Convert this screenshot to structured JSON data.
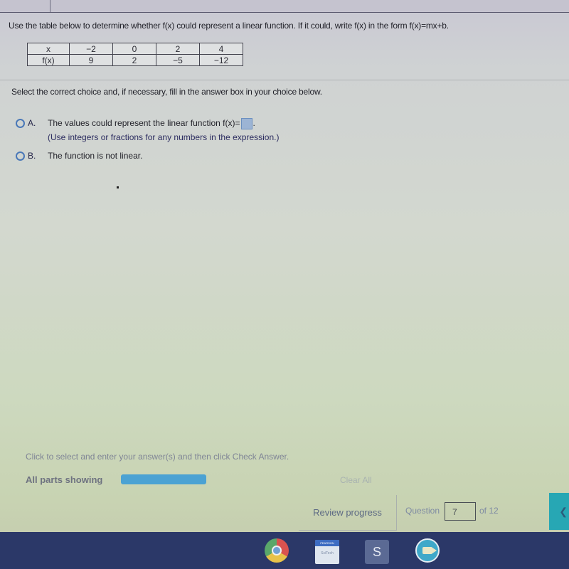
{
  "question": {
    "prompt": "Use the table below to determine whether f(x) could represent a linear function. If it could, write f(x) in the form f(x)=mx+b.",
    "table": {
      "row_headers": [
        "x",
        "f(x)"
      ],
      "x_values": [
        "−2",
        "0",
        "2",
        "4"
      ],
      "fx_values": [
        "9",
        "2",
        "−5",
        "−12"
      ]
    },
    "instruction": "Select the correct choice and, if necessary, fill in the answer box in your choice below.",
    "choices": [
      {
        "letter": "A.",
        "text": "The values could represent the linear function f(x)=",
        "suffix": ".",
        "hint": "(Use integers or fractions for any numbers in the expression.)",
        "answer_value": "",
        "selected": false
      },
      {
        "letter": "B.",
        "text": "The function is not linear.",
        "selected": false
      }
    ]
  },
  "footer": {
    "hint": "Click to select and enter your answer(s) and then click Check Answer.",
    "parts_label": "All parts showing",
    "parts_progress": 1.0,
    "clear_all": "Clear All",
    "review_progress": "Review progress",
    "question_label": "Question",
    "question_number": "7",
    "of_total": "of 12",
    "next_icon": "❮"
  },
  "shelf": {
    "apps": [
      {
        "name": "chrome-icon"
      },
      {
        "name": "pearson-icon",
        "top": "PEARSON",
        "bottom": "SciTech"
      },
      {
        "name": "schoology-icon",
        "label": "S"
      },
      {
        "name": "zoom-icon"
      }
    ]
  },
  "colors": {
    "accent_blue": "#4ba2d3",
    "next_button": "#27a7b4",
    "shelf": "#2b3868"
  }
}
